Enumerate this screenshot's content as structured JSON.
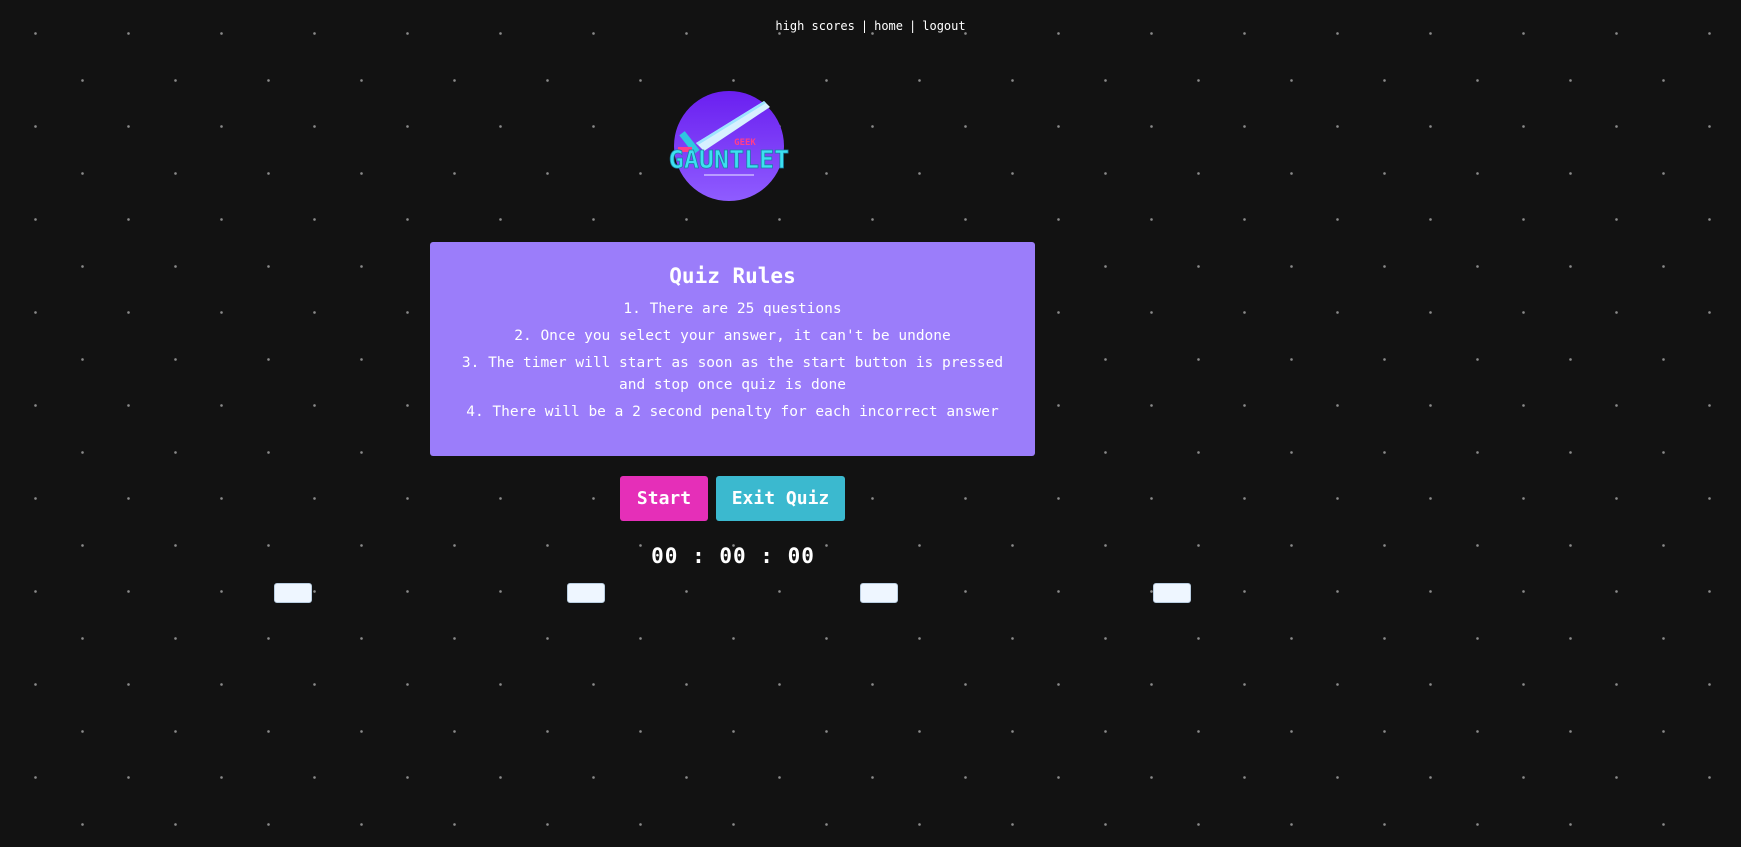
{
  "nav": {
    "high_scores": "high scores",
    "separator": "|",
    "home": "home",
    "logout": "logout"
  },
  "logo": {
    "text": "GAUNTLET",
    "icon": "sword-icon"
  },
  "rules": {
    "title": "Quiz Rules",
    "items": [
      "1. There are 25 questions",
      "2. Once you select your answer, it can't be undone",
      "3. The timer will start as soon as the start button is pressed and stop once quiz is done",
      "4. There will be a 2 second penalty for each incorrect answer"
    ]
  },
  "buttons": {
    "start": "Start",
    "exit": "Exit Quiz"
  },
  "timer": {
    "display": "00 : 00 : 00"
  },
  "colors": {
    "background": "#121212",
    "card": "#9b7dfa",
    "start_button": "#e52fb8",
    "exit_button": "#3bb9cf"
  }
}
